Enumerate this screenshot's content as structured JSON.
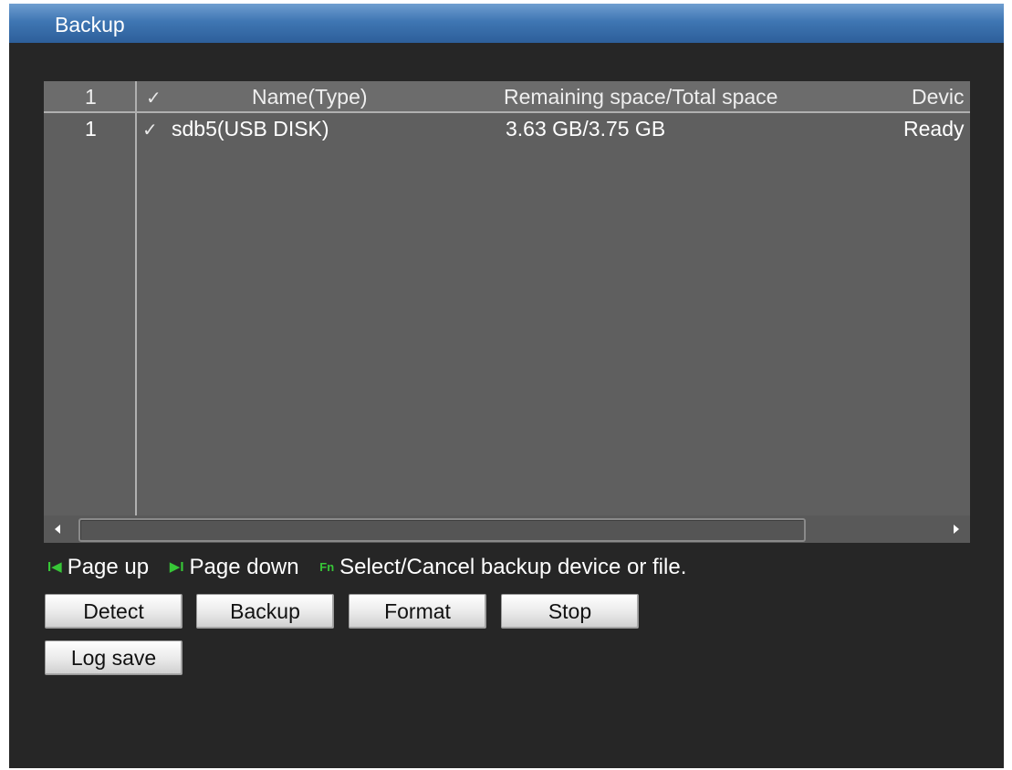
{
  "window": {
    "title": "Backup"
  },
  "table": {
    "header": {
      "index": "1",
      "check": "✓",
      "name": "Name(Type)",
      "space": "Remaining space/Total space",
      "device": "Devic"
    },
    "rows": [
      {
        "index": "1",
        "check": "✓",
        "name": "sdb5(USB DISK)",
        "space": "3.63 GB/3.75 GB",
        "device": "Ready"
      }
    ]
  },
  "hints": {
    "page_up_icon": "I◀",
    "page_up": "Page up",
    "page_down_icon": "▶I",
    "page_down": "Page down",
    "fn_icon": "Fn",
    "fn_text": "Select/Cancel backup device or file."
  },
  "buttons": {
    "detect": "Detect",
    "backup": "Backup",
    "format": "Format",
    "stop": "Stop",
    "log_save": "Log save"
  },
  "colors": {
    "title_bar": "#3f76b3",
    "background": "#262626",
    "table_bg": "#5f5f5f",
    "hint_icon": "#37c637"
  }
}
